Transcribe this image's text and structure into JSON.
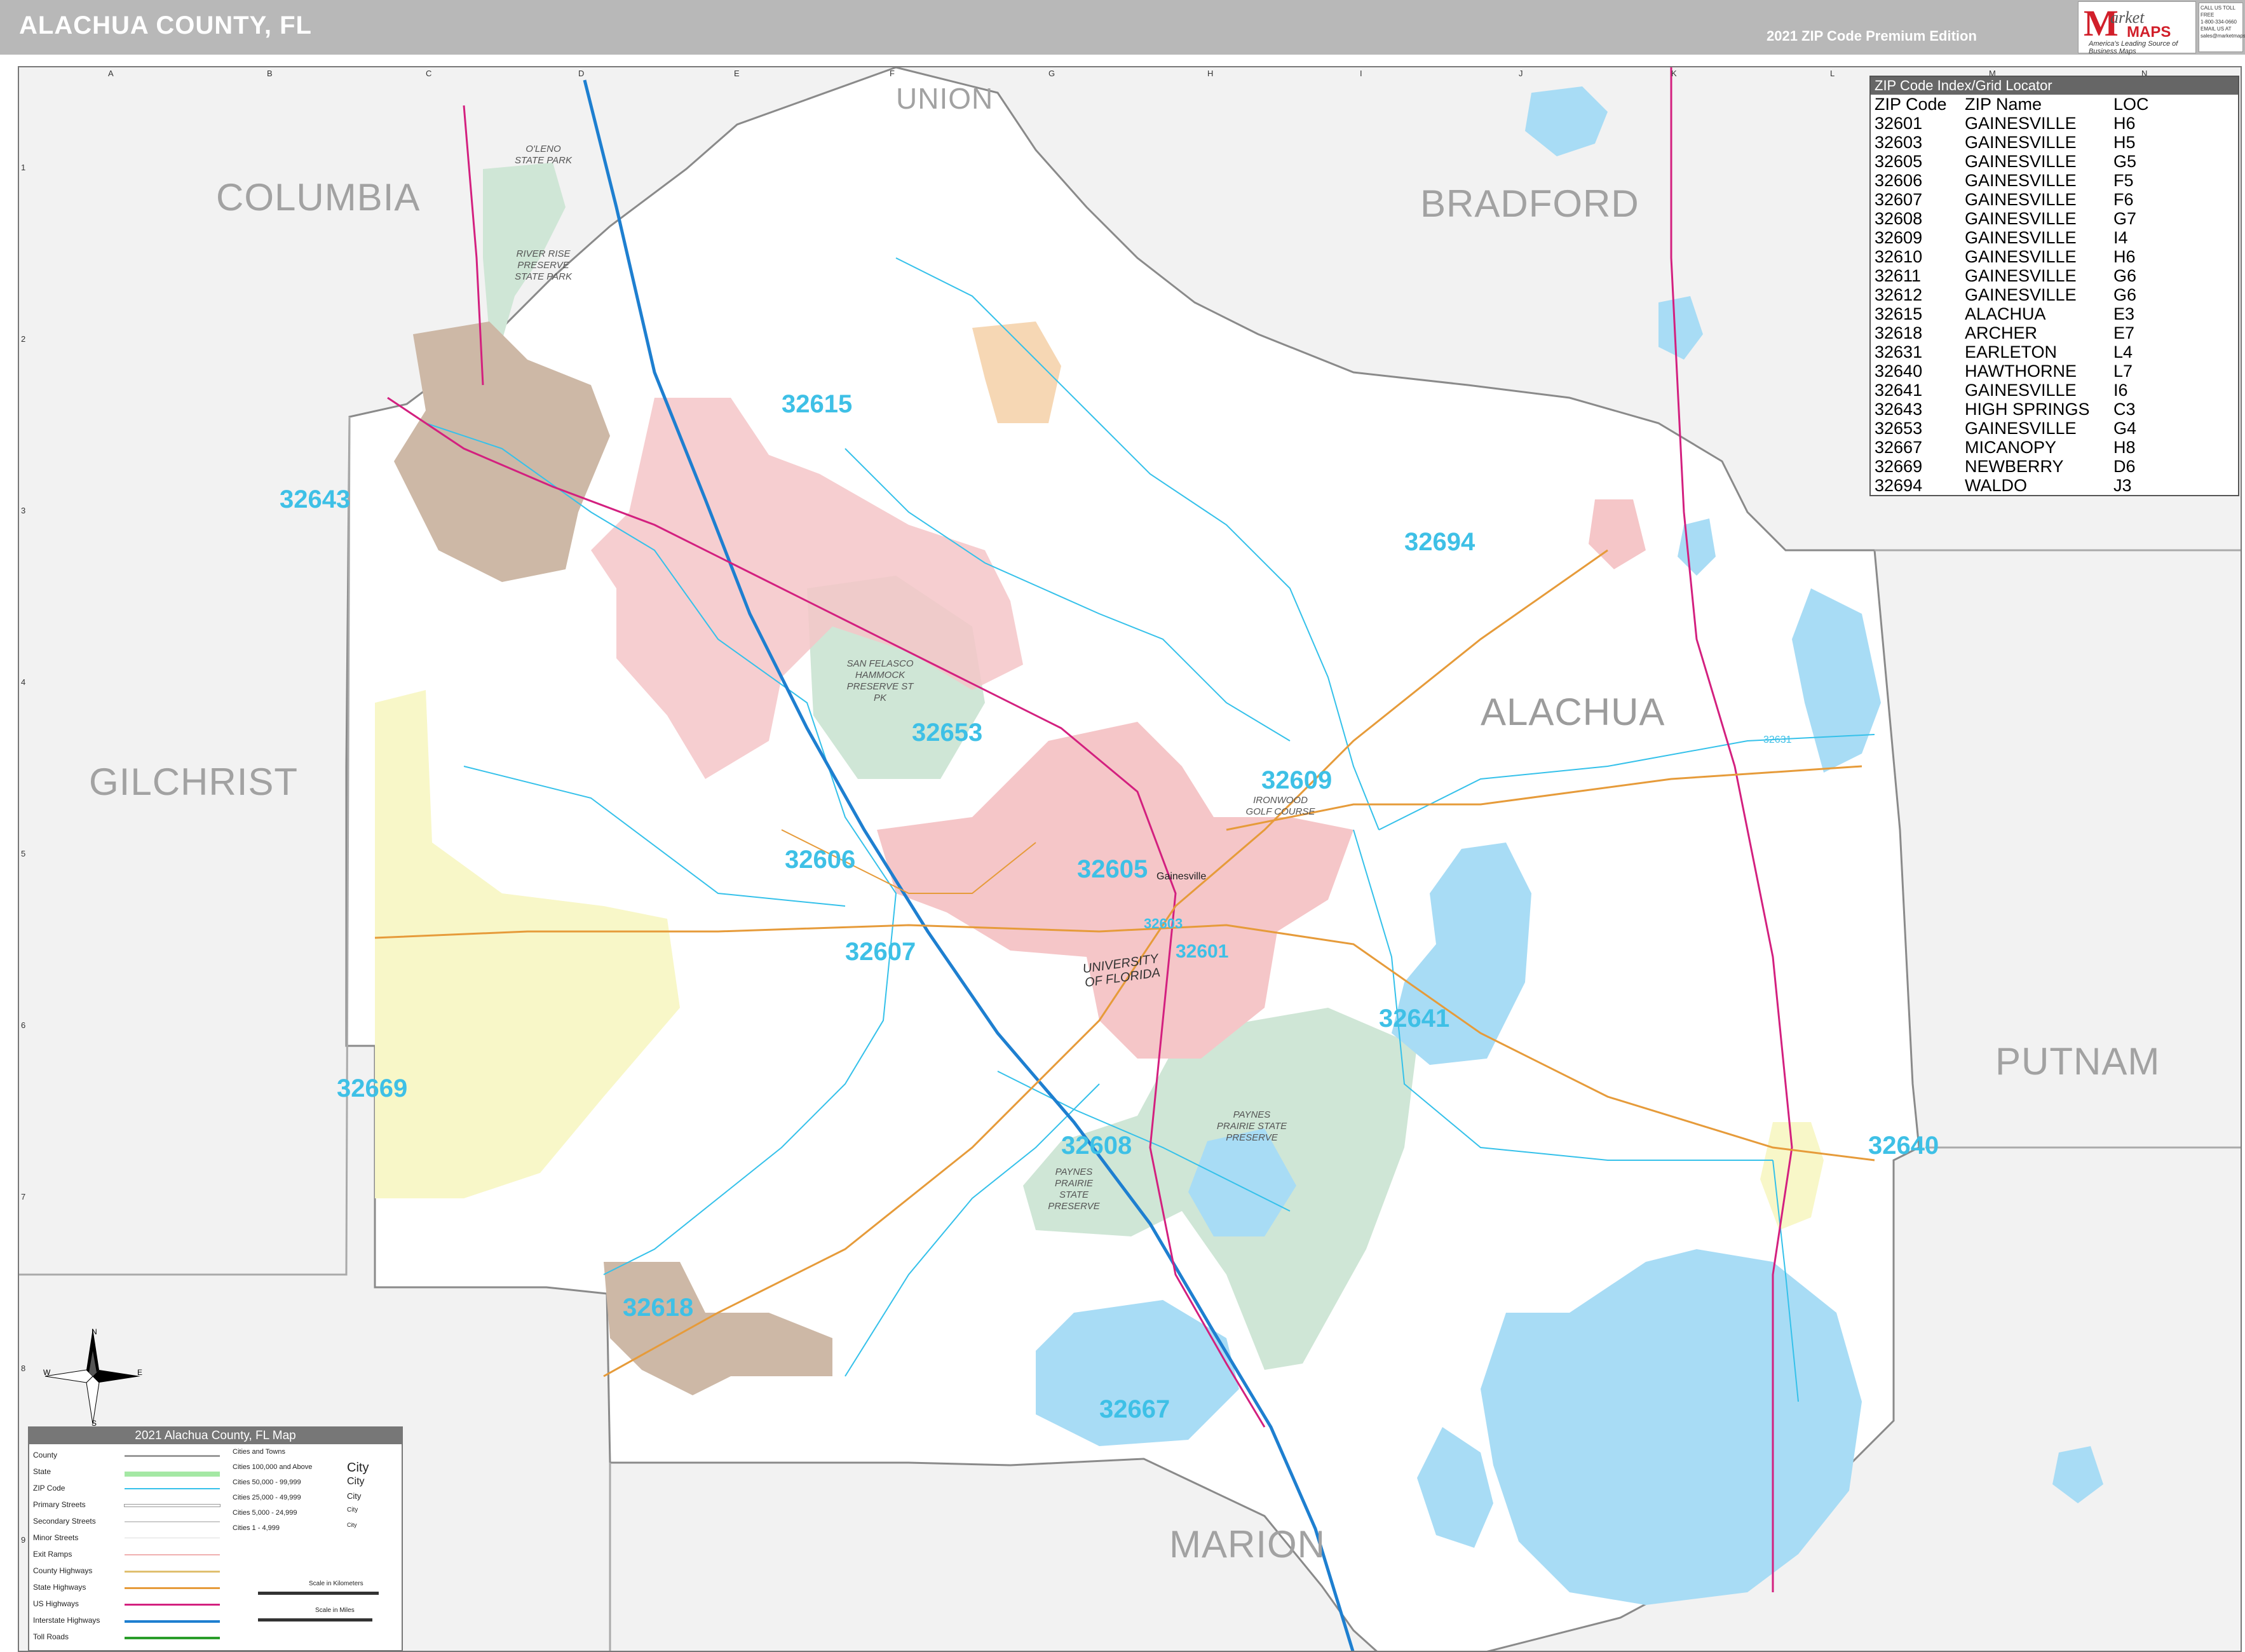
{
  "header": {
    "title": "ALACHUA COUNTY, FL",
    "edition": "2021 ZIP Code Premium Edition"
  },
  "logo": {
    "letter": "M",
    "word": "arket",
    "maps": "MAPS",
    "tagline": "America's Leading Source of Business Maps",
    "contact": [
      "CALL US TOLL FREE",
      "1-800-334-0660",
      "EMAIL US AT",
      "sales@marketmaps.com"
    ]
  },
  "grid": {
    "letters": [
      "A",
      "B",
      "C",
      "D",
      "E",
      "F",
      "G",
      "H",
      "I",
      "J",
      "K",
      "L",
      "M",
      "N"
    ],
    "numbers": [
      "1",
      "2",
      "3",
      "4",
      "5",
      "6",
      "7",
      "8",
      "9"
    ]
  },
  "counties": {
    "union": "UNION",
    "columbia": "COLUMBIA",
    "bradford": "BRADFORD",
    "alachua": "ALACHUA",
    "gilchrist": "GILCHRIST",
    "putnam": "PUTNAM",
    "marion": "MARION"
  },
  "zip_labels": {
    "z32615": "32615",
    "z32643": "32643",
    "z32694": "32694",
    "z32653": "32653",
    "z32609": "32609",
    "z32606": "32606",
    "z32605": "32605",
    "z32603": "32603",
    "z32607": "32607",
    "z32601": "32601",
    "z32641": "32641",
    "z32669": "32669",
    "z32608": "32608",
    "z32640": "32640",
    "z32618": "32618",
    "z32667": "32667",
    "z32631": "32631"
  },
  "places": {
    "oleno": "O'LENO STATE PARK",
    "river_rise": "RIVER RISE PRESERVE STATE PARK",
    "san_felasco": "SAN FELASCO HAMMOCK PRESERVE ST PK",
    "ironwood": "IRONWOOD GOLF COURSE",
    "paynes_prairie_east": "PAYNES PRAIRIE STATE PRESERVE",
    "paynes_prairie_west": "PAYNES PRAIRIE STATE PRESERVE",
    "university": "UNIVERSITY OF FLORIDA",
    "gainesville": "Gainesville"
  },
  "zip_index": {
    "title": "ZIP Code Index/Grid Locator",
    "columns": [
      "ZIP Code",
      "ZIP Name",
      "LOC"
    ],
    "rows": [
      [
        "32601",
        "GAINESVILLE",
        "H6"
      ],
      [
        "32603",
        "GAINESVILLE",
        "H5"
      ],
      [
        "32605",
        "GAINESVILLE",
        "G5"
      ],
      [
        "32606",
        "GAINESVILLE",
        "F5"
      ],
      [
        "32607",
        "GAINESVILLE",
        "F6"
      ],
      [
        "32608",
        "GAINESVILLE",
        "G7"
      ],
      [
        "32609",
        "GAINESVILLE",
        "I4"
      ],
      [
        "32610",
        "GAINESVILLE",
        "H6"
      ],
      [
        "32611",
        "GAINESVILLE",
        "G6"
      ],
      [
        "32612",
        "GAINESVILLE",
        "G6"
      ],
      [
        "32615",
        "ALACHUA",
        "E3"
      ],
      [
        "32618",
        "ARCHER",
        "E7"
      ],
      [
        "32631",
        "EARLETON",
        "L4"
      ],
      [
        "32640",
        "HAWTHORNE",
        "L7"
      ],
      [
        "32641",
        "GAINESVILLE",
        "I6"
      ],
      [
        "32643",
        "HIGH SPRINGS",
        "C3"
      ],
      [
        "32653",
        "GAINESVILLE",
        "G4"
      ],
      [
        "32667",
        "MICANOPY",
        "H8"
      ],
      [
        "32669",
        "NEWBERRY",
        "D6"
      ],
      [
        "32694",
        "WALDO",
        "J3"
      ]
    ]
  },
  "legend": {
    "title": "2021 Alachua County, FL Map",
    "left_items": [
      "County",
      "State",
      "ZIP Code",
      "Primary Streets",
      "Secondary Streets",
      "Minor Streets",
      "Exit Ramps",
      "County Highways",
      "State Highways",
      "US Highways",
      "Interstate Highways",
      "Toll Roads"
    ],
    "cities_header": "Cities and Towns",
    "cities": [
      {
        "label": "Cities 100,000 and Above",
        "sample": "City"
      },
      {
        "label": "Cities 50,000 - 99,999",
        "sample": "City"
      },
      {
        "label": "Cities 25,000 - 49,999",
        "sample": "City"
      },
      {
        "label": "Cities 5,000 - 24,999",
        "sample": "City"
      },
      {
        "label": "Cities 1 - 4,999",
        "sample": "City"
      }
    ],
    "scale_km": "Scale in Kilometers",
    "scale_mi": "Scale in Miles"
  },
  "compass": {
    "n": "N",
    "s": "S",
    "e": "E",
    "w": "W"
  },
  "colors": {
    "water": "#a8dcf5",
    "zip_label": "#3ec0e6",
    "zip_boundary": "#35c1ea",
    "interstate": "#1e7fd0",
    "us_highway": "#d3207f",
    "state_highway": "#e69b3a",
    "park": "#cfe6d6",
    "city_pink": "#f5c6c8",
    "city_tan": "#cdb8a6",
    "city_yellow": "#f8f7c8",
    "city_orange": "#f6d7b4"
  }
}
